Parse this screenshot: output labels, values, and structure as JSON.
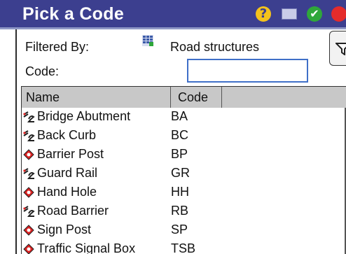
{
  "title": "Pick a Code",
  "titlebar_icons": {
    "help": "?",
    "ok": "✔"
  },
  "filter": {
    "label": "Filtered By:",
    "value": "Road structures"
  },
  "code": {
    "label": "Code:",
    "value": ""
  },
  "columns": {
    "name": "Name",
    "code": "Code"
  },
  "rows": [
    {
      "name": "Bridge Abutment",
      "code": "BA",
      "icon": "line-icon"
    },
    {
      "name": "Back Curb",
      "code": "BC",
      "icon": "line-icon"
    },
    {
      "name": "Barrier Post",
      "code": "BP",
      "icon": "point-icon"
    },
    {
      "name": "Guard Rail",
      "code": "GR",
      "icon": "line-icon"
    },
    {
      "name": "Hand Hole",
      "code": "HH",
      "icon": "point-icon"
    },
    {
      "name": "Road Barrier",
      "code": "RB",
      "icon": "line-icon"
    },
    {
      "name": "Sign Post",
      "code": "SP",
      "icon": "point-icon"
    },
    {
      "name": "Traffic Signal Box",
      "code": "TSB",
      "icon": "point-icon"
    }
  ],
  "colors": {
    "titlebar": "#3c3f8f",
    "header": "#c8c8c8",
    "input_border": "#3f6fc8"
  }
}
